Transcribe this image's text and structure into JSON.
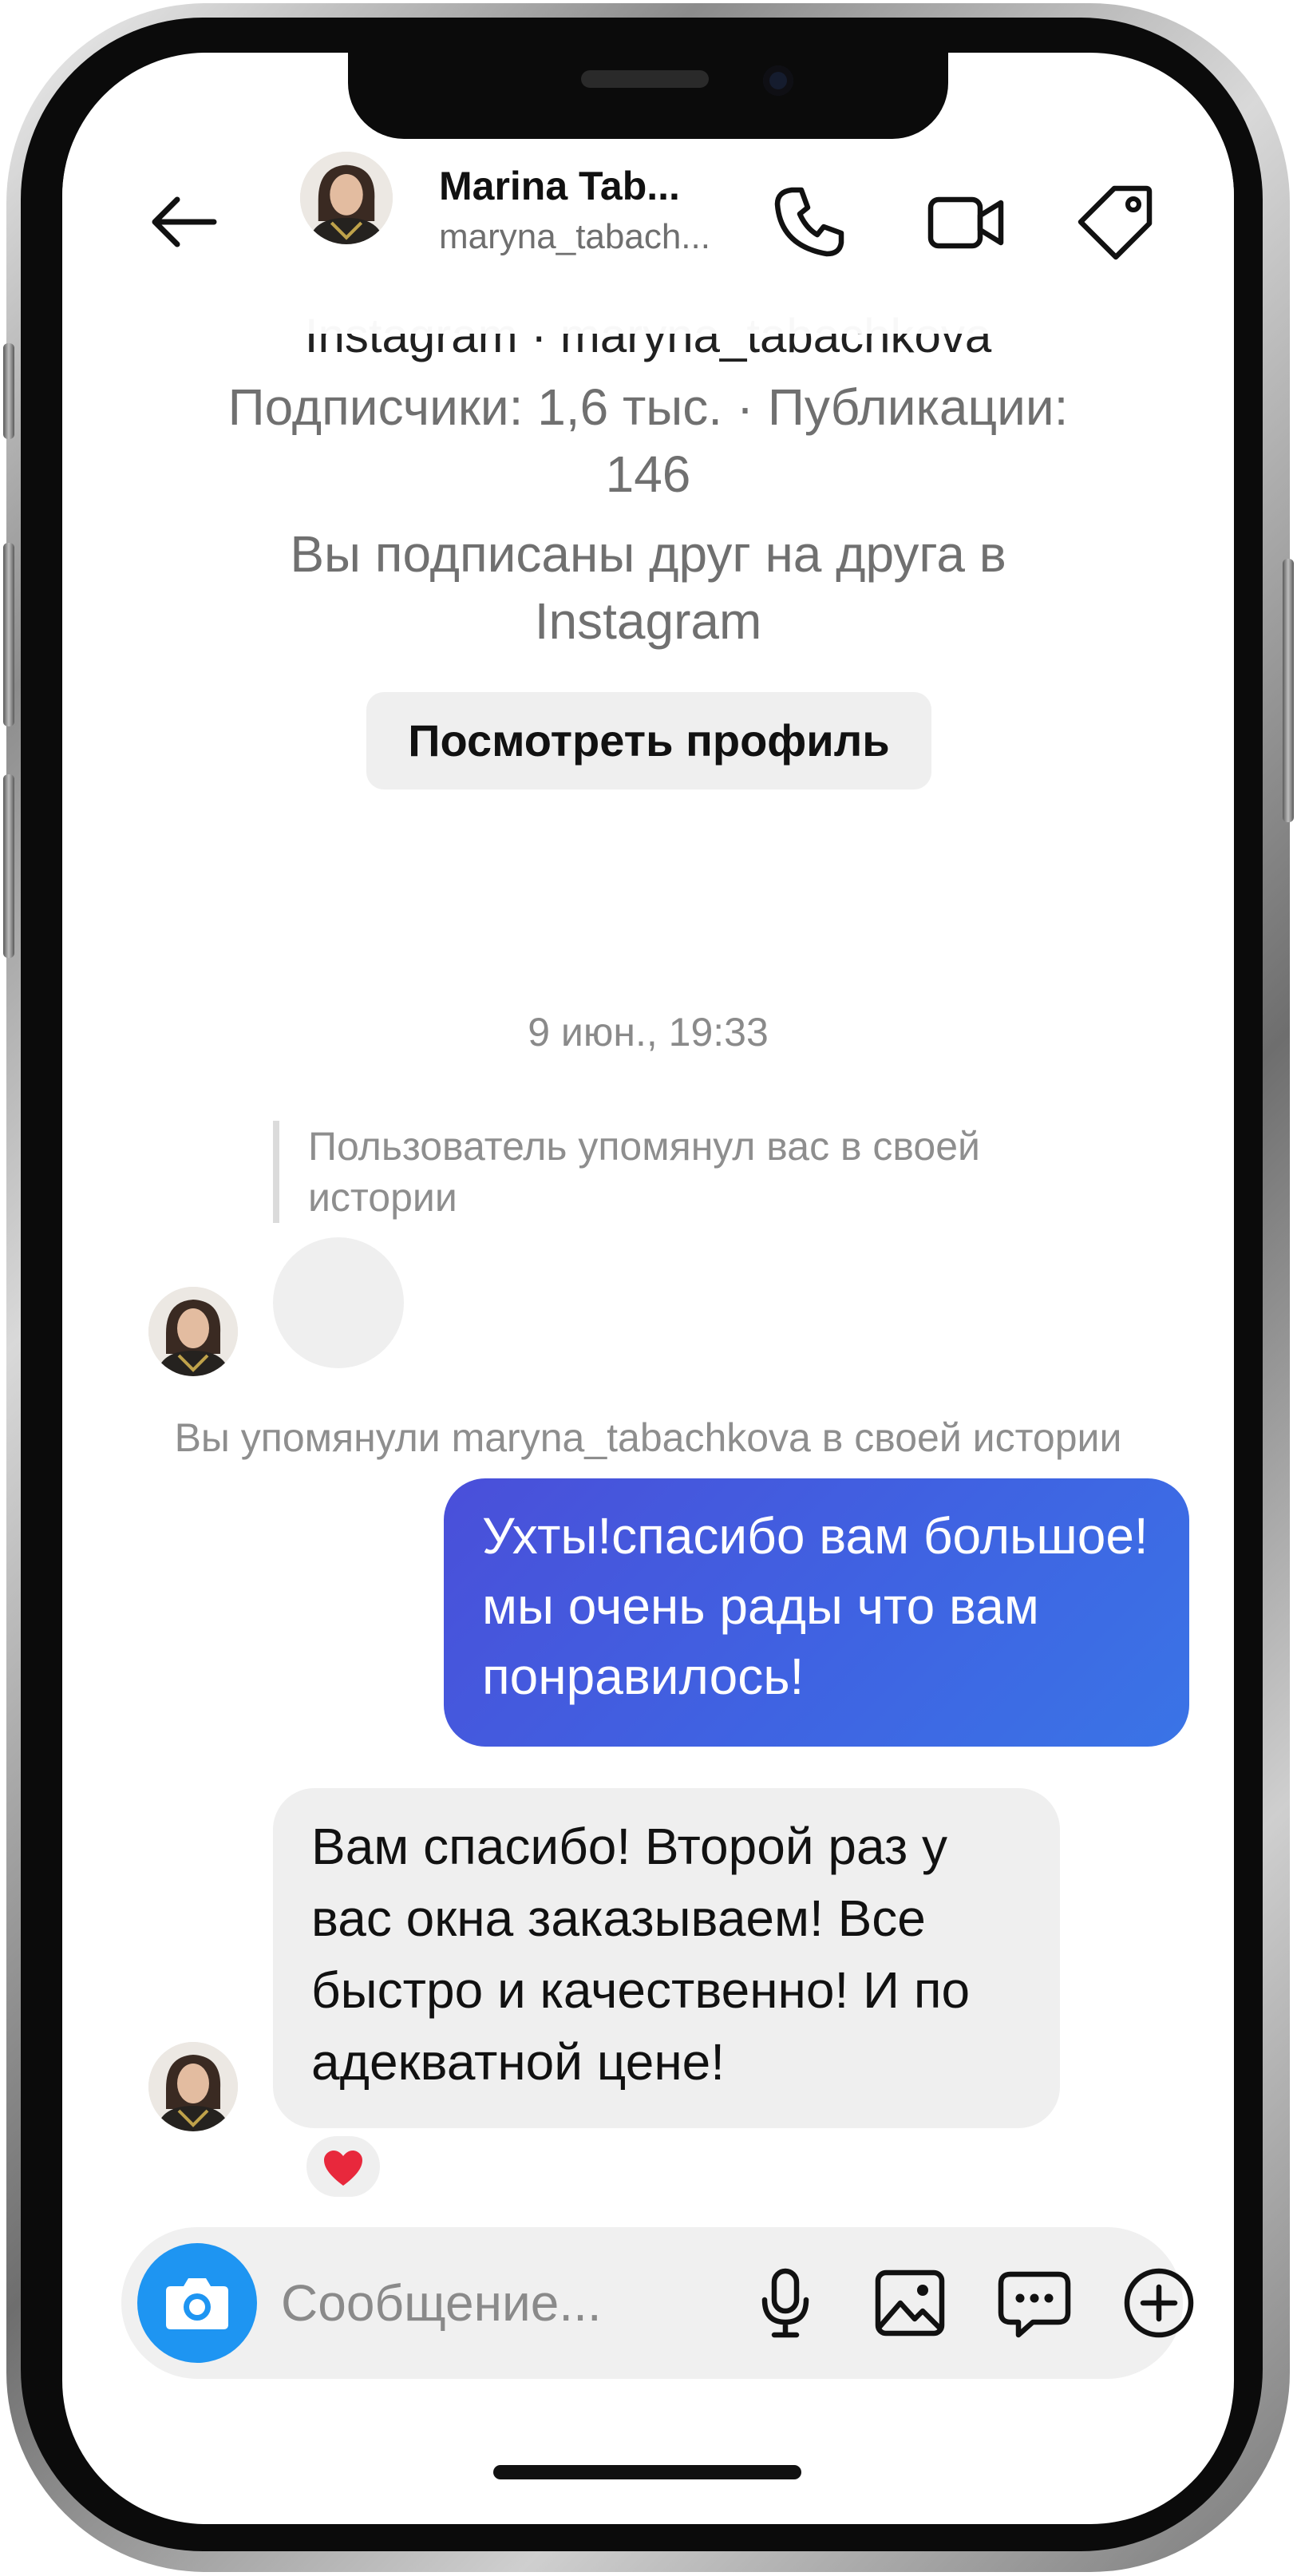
{
  "header": {
    "name": "Marina Tab...",
    "username": "maryna_tabach..."
  },
  "profile_card": {
    "partial_line": "Instagram · maryna_tabachkova",
    "stats": "Подписчики: 1,6 тыс. · Публикации: 146",
    "mutual": "Вы подписаны друг на друга в Instagram",
    "view_profile_label": "Посмотреть профиль"
  },
  "thread": {
    "timestamp": "9 июн., 19:33",
    "mention_note": "Пользователь упомянул вас в своей истории",
    "you_mentioned": "Вы упомянули maryna_tabachkova в своей истории",
    "outgoing_message": "Ухты!спасибо вам большое!мы очень рады что вам понравилось!",
    "incoming_message": "Вам спасибо! Второй раз у вас окна заказываем! Все быстро и качественно! И по адекватной цене!",
    "reaction": "❤️"
  },
  "composer": {
    "placeholder": "Сообщение..."
  },
  "colors": {
    "outgoing_bubble": "#4a5ddf",
    "incoming_bubble": "#efefef",
    "camera_button": "#1e95f2"
  },
  "icons": [
    "back-arrow-icon",
    "phone-icon",
    "video-icon",
    "tag-icon",
    "camera-icon",
    "microphone-icon",
    "image-icon",
    "sticker-message-icon",
    "plus-icon",
    "heart-icon"
  ]
}
